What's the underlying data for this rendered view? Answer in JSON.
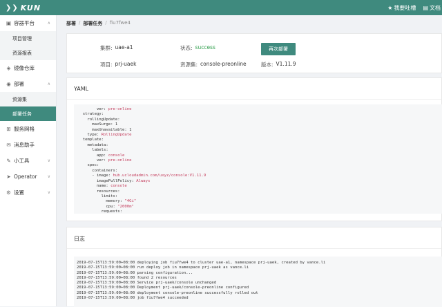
{
  "header": {
    "logo_text": "KUN",
    "feedback_label": "我要吐槽",
    "docs_label": "文档"
  },
  "sidebar": {
    "groups": [
      {
        "label": "容器平台",
        "icon": "server-icon",
        "chevron": "∧"
      },
      {
        "label": "镜像仓库",
        "icon": "box-icon"
      },
      {
        "label": "部署",
        "icon": "deploy-icon",
        "chevron": "∧"
      },
      {
        "label": "服务网格",
        "icon": "grid-icon"
      },
      {
        "label": "消息助手",
        "icon": "message-icon"
      },
      {
        "label": "小工具",
        "icon": "tool-icon",
        "chevron": "∨"
      },
      {
        "label": "Operator",
        "icon": "operator-icon",
        "chevron": "∨"
      },
      {
        "label": "设置",
        "icon": "gear-icon",
        "chevron": "∨"
      }
    ],
    "subs": {
      "project_mgmt": "项目管理",
      "resource_report": "资源报表",
      "resource_set": "资源集",
      "deploy_task": "部署任务"
    }
  },
  "breadcrumb": {
    "root": "部署",
    "section": "部署任务",
    "current": "fiu7fwe4",
    "sep": "/"
  },
  "info": {
    "cluster_label": "集群:",
    "cluster_value": "uae-a1",
    "status_label": "状态:",
    "status_value": "success",
    "project_label": "项目:",
    "project_value": "prj-uaek",
    "resource_label": "资源集:",
    "resource_value": "console-preonline",
    "version_label": "版本:",
    "version_value": "V1.11.9",
    "redeploy_label": "再次部署",
    "status_color": "#2e9e4b",
    "accent_color": "#3f8a7e"
  },
  "yaml": {
    "title": "YAML",
    "lines": [
      {
        "k": "        ver: ",
        "v": "pre-online"
      },
      {
        "k": "  strategy:",
        "v": ""
      },
      {
        "k": "    rollingUpdate:",
        "v": ""
      },
      {
        "k": "      maxSurge: 1",
        "v": ""
      },
      {
        "k": "      maxUnavailable: 1",
        "v": ""
      },
      {
        "k": "    type: ",
        "v": "RollingUpdate"
      },
      {
        "k": "  template:",
        "v": ""
      },
      {
        "k": "    metadata:",
        "v": ""
      },
      {
        "k": "      labels:",
        "v": ""
      },
      {
        "k": "        app: ",
        "v": "console"
      },
      {
        "k": "        ver: ",
        "v": "pre-online"
      },
      {
        "k": "    spec:",
        "v": ""
      },
      {
        "k": "      containers:",
        "v": ""
      },
      {
        "k": "      - image: ",
        "v": "hub.ucloudadmin.com/uxyz/console:V1.11.9"
      },
      {
        "k": "        imagePullPolicy: ",
        "v": "Always"
      },
      {
        "k": "        name: ",
        "v": "console"
      },
      {
        "k": "        resources:",
        "v": ""
      },
      {
        "k": "          limits:",
        "v": ""
      },
      {
        "k": "            memory: ",
        "v": "\"4Gi\""
      },
      {
        "k": "            cpu: ",
        "v": "\"2000m\""
      },
      {
        "k": "          requests:",
        "v": ""
      }
    ]
  },
  "log": {
    "title": "日志",
    "lines": [
      "2019-07-15T13:59:00+08:00 deploying job fiu7fwe4 to cluster uae-a1, namespace prj-uaek, created by vance.li",
      "2019-07-15T13:59:00+08:00 run deploy job in namespace prj-uaek as vance.li",
      "2019-07-15T13:59:00+08:00 parsing configuration...",
      "2019-07-15T13:59:00+08:00 found 2 resources",
      "2019-07-15T13:59:00+08:00 Service prj-uaek/console unchanged",
      "2019-07-15T13:59:00+08:00 Deployment prj-uaek/console-preonline configured",
      "2019-07-15T13:59:00+08:00 deployment console-preonline successfully rolled out",
      "2019-07-15T13:59:00+08:00 job fiu7fwe4 succeeded"
    ]
  }
}
